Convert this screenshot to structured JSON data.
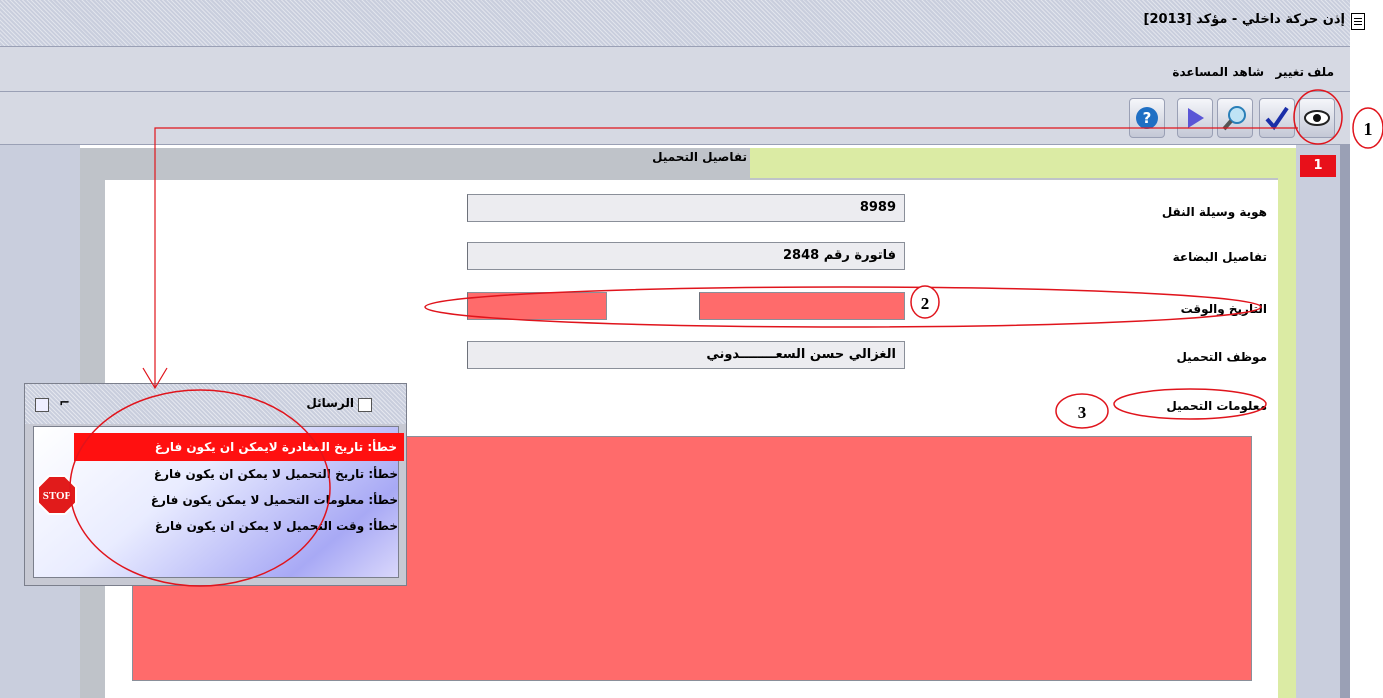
{
  "window": {
    "title": "إذن حركة داخلي - مؤكد [2013]"
  },
  "menu": {
    "items": [
      "ملف",
      "تغيير",
      "شاهد",
      "المساعدة"
    ]
  },
  "toolbar": {
    "buttons": [
      "view-icon",
      "check-icon",
      "search-icon",
      "play-icon",
      "help-icon"
    ]
  },
  "form": {
    "section_title": "تفاصيل التحميل",
    "page_number": "1",
    "fields": {
      "vehicle_id": {
        "label": "هوية وسيلة النقل",
        "value": "8989"
      },
      "goods_details": {
        "label": "تفاصيل البضاعة",
        "value": "فاتورة رقم 2848"
      },
      "date_time": {
        "label": "التاريخ والوقت",
        "date_value": "",
        "time_value": ""
      },
      "loading_employee": {
        "label": "موظف التحميل",
        "value": "الغزالي حسن السعــــــــدوني"
      },
      "loading_info": {
        "label": "معلومات التحميل",
        "value": ""
      }
    }
  },
  "messages_dialog": {
    "title": "الرسائل",
    "stop_label": "STOP",
    "messages": [
      "خطأ: تاريخ المغادرة لايمكن ان يكون فارغ",
      "خطأ: تاريخ التحميل لا يمكن ان يكون فارغ",
      "خطأ: معلومات التحميل لا يمكن يكون فارغ",
      "خطأ: وقت التحميل لا يمكن ان يكون فارغ"
    ],
    "selected_index": 0
  },
  "annotations": {
    "markers": [
      "1",
      "2",
      "3"
    ]
  },
  "colors": {
    "error_fill": "#ff6b6b",
    "selected_message": "#ff1010",
    "badge": "#e8101a",
    "highlight_green": "#dbeba4"
  }
}
